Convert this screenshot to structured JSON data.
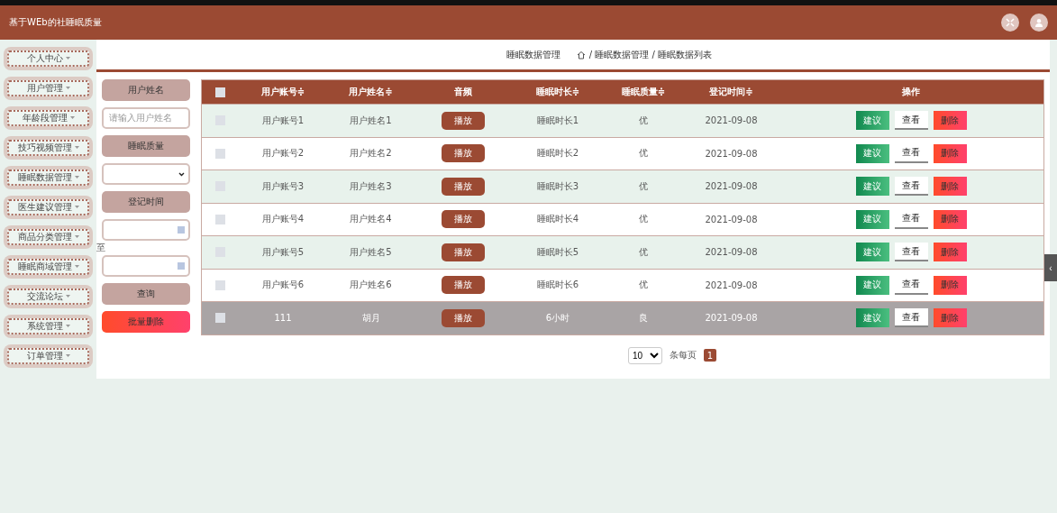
{
  "header": {
    "title": "基于WEb的社睡眠质量"
  },
  "sidebar": {
    "items": [
      {
        "label": "个人中心"
      },
      {
        "label": "用户管理"
      },
      {
        "label": "年龄段管理"
      },
      {
        "label": "技巧视频管理"
      },
      {
        "label": "睡眠数据管理"
      },
      {
        "label": "医生建议管理"
      },
      {
        "label": "商品分类管理"
      },
      {
        "label": "睡眠商域管理"
      },
      {
        "label": "交流论坛"
      },
      {
        "label": "系统管理"
      },
      {
        "label": "订单管理"
      }
    ]
  },
  "breadcrumb": {
    "title": "睡眠数据管理",
    "path": "/ 睡眠数据管理 / 睡眠数据列表"
  },
  "filters": {
    "name_label": "用户姓名",
    "name_placeholder": "请输入用户姓名",
    "quality_label": "睡眠质量",
    "time_label": "登记时间",
    "range_sep": "至",
    "search_button": "查询",
    "batch_delete_button": "批量删除"
  },
  "table": {
    "columns": [
      "用户账号≑",
      "用户姓名≑",
      "音频",
      "睡眠时长≑",
      "睡眠质量≑",
      "登记时间≑",
      "操作"
    ],
    "rows": [
      {
        "account": "用户账号1",
        "name": "用户姓名1",
        "audio": "播放",
        "duration": "睡眠时长1",
        "quality": "优",
        "date": "2021-09-08",
        "hovered": false,
        "checked": false,
        "actions": [
          "建议",
          "查看",
          "删除"
        ]
      },
      {
        "account": "用户账号2",
        "name": "用户姓名2",
        "audio": "播放",
        "duration": "睡眠时长2",
        "quality": "优",
        "date": "2021-09-08",
        "hovered": false,
        "checked": false,
        "actions": [
          "建议",
          "查看",
          "删除"
        ]
      },
      {
        "account": "用户账号3",
        "name": "用户姓名3",
        "audio": "播放",
        "duration": "睡眠时长3",
        "quality": "优",
        "date": "2021-09-08",
        "hovered": false,
        "checked": false,
        "actions": [
          "建议",
          "查看",
          "删除"
        ]
      },
      {
        "account": "用户账号4",
        "name": "用户姓名4",
        "audio": "播放",
        "duration": "睡眠时长4",
        "quality": "优",
        "date": "2021-09-08",
        "hovered": false,
        "checked": false,
        "actions": [
          "建议",
          "查看",
          "删除"
        ]
      },
      {
        "account": "用户账号5",
        "name": "用户姓名5",
        "audio": "播放",
        "duration": "睡眠时长5",
        "quality": "优",
        "date": "2021-09-08",
        "hovered": false,
        "checked": false,
        "actions": [
          "建议",
          "查看",
          "删除"
        ]
      },
      {
        "account": "用户账号6",
        "name": "用户姓名6",
        "audio": "播放",
        "duration": "睡眠时长6",
        "quality": "优",
        "date": "2021-09-08",
        "hovered": false,
        "checked": false,
        "actions": [
          "建议",
          "查看",
          "删除"
        ]
      },
      {
        "account": "111",
        "name": "胡月",
        "audio": "播放",
        "duration": "6小时",
        "quality": "良",
        "date": "2021-09-08",
        "hovered": true,
        "checked": false,
        "actions": [
          "建议",
          "查看",
          "删除"
        ]
      }
    ],
    "select_all_checked": false
  },
  "pagination": {
    "page_size": "10",
    "per_page_label": "条每页",
    "pages": [
      {
        "label": "1",
        "selected": true
      }
    ]
  },
  "side_toggle": "‹"
}
